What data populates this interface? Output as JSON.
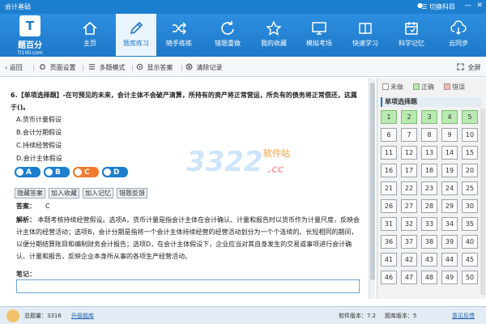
{
  "titlebar": {
    "title": "会计基础",
    "switch_subject": "切换科目"
  },
  "logo": {
    "mark": "T",
    "name": "题百分",
    "url": "TI100.com"
  },
  "nav": [
    {
      "label": "主页",
      "icon": "home-icon"
    },
    {
      "label": "题库练习",
      "icon": "pencil-icon"
    },
    {
      "label": "随手练练",
      "icon": "shuffle-icon"
    },
    {
      "label": "错题重做",
      "icon": "refresh-icon"
    },
    {
      "label": "我的收藏",
      "icon": "star-icon"
    },
    {
      "label": "模拟考场",
      "icon": "monitor-icon"
    },
    {
      "label": "快速学习",
      "icon": "book-icon"
    },
    {
      "label": "科学记忆",
      "icon": "calendar-icon"
    },
    {
      "label": "云同步",
      "icon": "cloud-sync-icon"
    }
  ],
  "toolbar": {
    "back": "返回",
    "page_settings": "页面设置",
    "multi_mode": "多题模式",
    "show_answer": "显示答案",
    "clear_records": "清除记录",
    "fullscreen": "全屏"
  },
  "question": {
    "text": "6.【单项选择题】-在可预见的未来，会计主体不会破产清算，所持有的资产将正常营运，所负有的债务将正常偿还，这属于()。",
    "options": [
      "A.货币计量假设",
      "B.会计分期假设",
      "C.持续经营假设",
      "D.会计主体假设"
    ],
    "answer_buttons": [
      "A",
      "B",
      "C",
      "D"
    ],
    "selected_wrong": "C"
  },
  "actions": [
    "隐藏答案",
    "加入收藏",
    "加入记忆",
    "错题反馈"
  ],
  "answer": {
    "label": "答案：",
    "value": "C"
  },
  "explanation": {
    "label": "解析：",
    "text": "本题考核持续经营假设。选项A，货币计量是指会计主体在会计确认、计量和报告时以货币作为计量尺度，反映会计主体的经营活动；选项B，会计分期是指将一个会计主体持续经营的经营活动划分为一个个连续的、长短相同的期间，以便分期结算账目和编制财务会计报告；选项D，在会计主体假设下，企业应当对其自身发生的交易或事项进行会计确认、计量和报告，反映企业本身所从事的各项生产经营活动。"
  },
  "notes": {
    "label": "笔记：",
    "value": ""
  },
  "watermark": {
    "number": "3322",
    "site": "软件站",
    "domain": ".cc"
  },
  "legend": {
    "undone": "未做",
    "correct": "正确",
    "wrong": "错误"
  },
  "sheet": {
    "title": "单项选择题",
    "numbers": [
      "1",
      "2",
      "3",
      "4",
      "5",
      "6",
      "7",
      "8",
      "9",
      "10",
      "11",
      "12",
      "13",
      "14",
      "15",
      "16",
      "17",
      "18",
      "19",
      "20",
      "21",
      "22",
      "23",
      "24",
      "25",
      "26",
      "27",
      "28",
      "29",
      "30",
      "31",
      "32",
      "33",
      "34",
      "35",
      "36",
      "37",
      "38",
      "39",
      "40",
      "41",
      "42",
      "43",
      "44",
      "45",
      "46",
      "47",
      "48",
      "49",
      "50"
    ],
    "correct": [
      "1",
      "2",
      "3",
      "4",
      "5"
    ]
  },
  "status": {
    "total_label": "总题量：",
    "total_value": "3316",
    "upgrade": "升级题库",
    "software_version": "软件版本：7.2",
    "bank_version": "题库版本：5",
    "feedback": "意见反馈"
  },
  "colors": {
    "primary": "#1e78c8",
    "correct": "#b9eab1",
    "wrong_selected": "#f07a2e"
  }
}
